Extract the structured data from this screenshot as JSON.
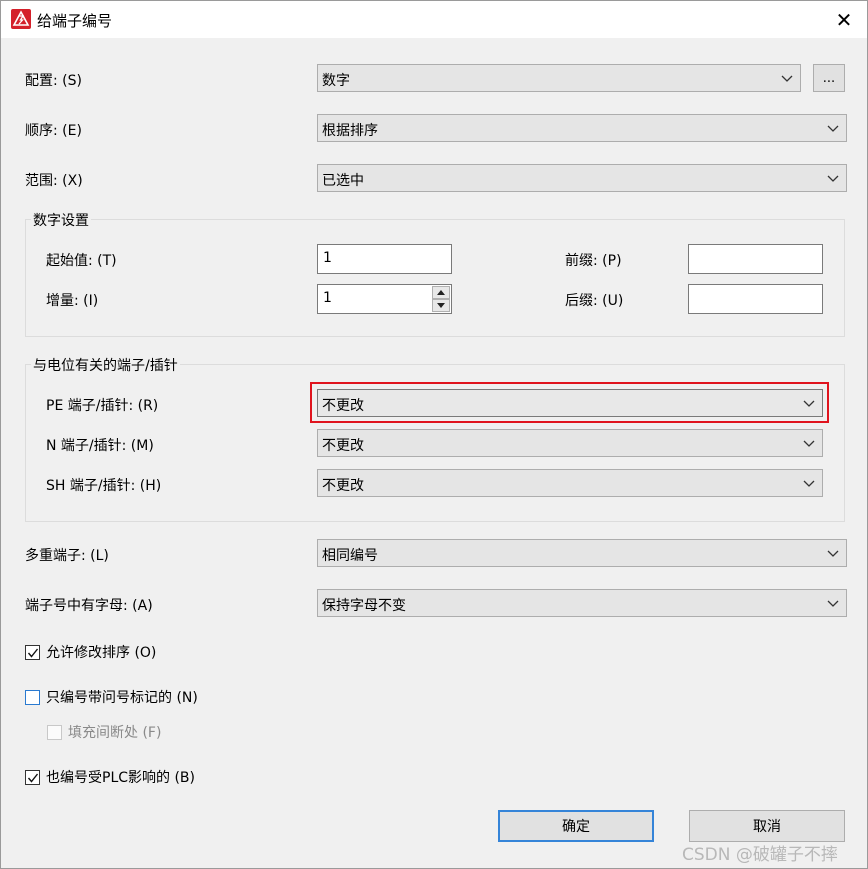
{
  "window": {
    "title": "给端子编号",
    "close_glyph": "✕"
  },
  "fields": {
    "config": {
      "label": "配置: (S)",
      "value": "数字",
      "more_label": "..."
    },
    "order": {
      "label": "顺序: (E)",
      "value": "根据排序"
    },
    "range": {
      "label": "范围: (X)",
      "value": "已选中"
    }
  },
  "number_settings": {
    "title": "数字设置",
    "start": {
      "label": "起始值: (T)",
      "value": "1"
    },
    "increment": {
      "label": "增量: (I)",
      "value": "1"
    },
    "prefix": {
      "label": "前缀: (P)",
      "value": ""
    },
    "suffix": {
      "label": "后缀: (U)",
      "value": ""
    }
  },
  "potential_group": {
    "title": "与电位有关的端子/插针",
    "pe": {
      "label": "PE 端子/插针: (R)",
      "value": "不更改"
    },
    "n": {
      "label": "N 端子/插针: (M)",
      "value": "不更改"
    },
    "sh": {
      "label": "SH 端子/插针: (H)",
      "value": "不更改"
    }
  },
  "multi_terminal": {
    "label": "多重端子: (L)",
    "value": "相同编号"
  },
  "letters_in_terminal": {
    "label": "端子号中有字母: (A)",
    "value": "保持字母不变"
  },
  "checkboxes": {
    "allow_change_order": {
      "label": "允许修改排序 (O)",
      "checked": true
    },
    "only_question_mark": {
      "label": "只编号带问号标记的 (N)",
      "checked": false
    },
    "fill_gaps": {
      "label": "填充间断处 (F)",
      "checked": false,
      "enabled": false
    },
    "plc_affected": {
      "label": "也编号受PLC影响的 (B)",
      "checked": true
    }
  },
  "buttons": {
    "ok": "确定",
    "cancel": "取消"
  },
  "watermark": "CSDN @破罐子不摔",
  "colors": {
    "highlight_border": "#e0141e",
    "default_button_border": "#3584d8",
    "app_icon": "#d4202a"
  },
  "icons": {
    "app": "app-logo-icon",
    "close": "close-icon",
    "dropdown": "chevron-down-icon",
    "spin_up": "triangle-up-icon",
    "spin_down": "triangle-down-icon",
    "check": "checkmark-icon"
  }
}
